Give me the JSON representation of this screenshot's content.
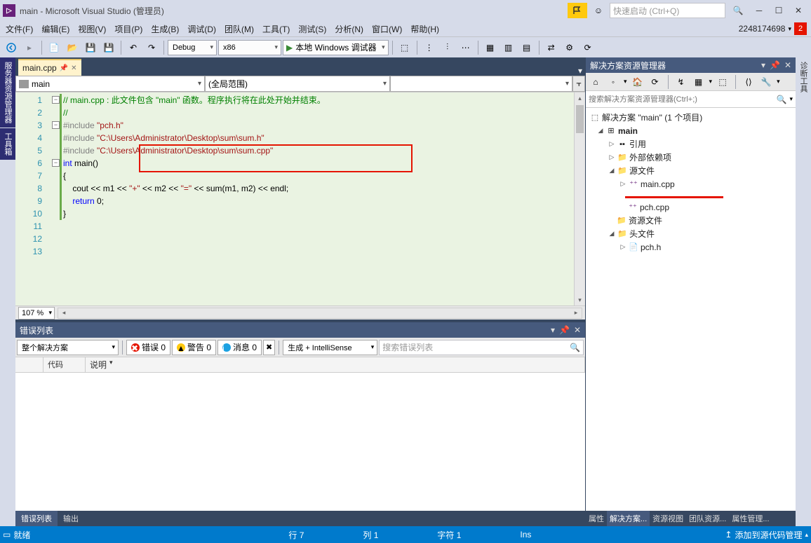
{
  "titlebar": {
    "title": "main - Microsoft Visual Studio  (管理员)",
    "quick_launch_placeholder": "快速启动 (Ctrl+Q)"
  },
  "menubar": {
    "items": [
      "文件(F)",
      "编辑(E)",
      "视图(V)",
      "项目(P)",
      "生成(B)",
      "调试(D)",
      "团队(M)",
      "工具(T)",
      "测试(S)",
      "分析(N)",
      "窗口(W)",
      "帮助(H)"
    ],
    "account_id": "2248174698",
    "notification_count": "2"
  },
  "toolbar": {
    "config": "Debug",
    "platform": "x86",
    "debug_button": "本地 Windows 调试器"
  },
  "doc_tab": {
    "name": "main.cpp"
  },
  "nav": {
    "scope": "main",
    "member": "(全局范围)"
  },
  "editor": {
    "lines": [
      {
        "n": 1,
        "fold": true,
        "cls": "c-comment",
        "text": "// main.cpp : 此文件包含 \"main\" 函数。程序执行将在此处开始并结束。"
      },
      {
        "n": 2,
        "cls": "c-comment",
        "text": "//"
      },
      {
        "n": 3,
        "text": ""
      },
      {
        "n": 4,
        "fold": true,
        "html": "<span class='c-preproc'>#include</span> <span class='c-string'>\"pch.h\"</span>"
      },
      {
        "n": 5,
        "html": "<span class='c-preproc'>#include</span> <span class='c-string'>\"C:\\Users\\Administrator\\Desktop\\sum\\sum.h\"</span>"
      },
      {
        "n": 6,
        "html": "<span class='c-preproc'>#include</span> <span class='c-string'>\"C:\\Users\\Administrator\\Desktop\\sum\\sum.cpp\"</span>"
      },
      {
        "n": 7,
        "text": ""
      },
      {
        "n": 8,
        "fold": true,
        "html": "<span class='c-keyword'>int</span> main()"
      },
      {
        "n": 9,
        "text": "{"
      },
      {
        "n": 10,
        "html": "    cout &lt;&lt; m1 &lt;&lt; <span class='c-string'>\"+\"</span> &lt;&lt; m2 &lt;&lt; <span class='c-string'>\"=\"</span> &lt;&lt; sum(m1, m2) &lt;&lt; endl;"
      },
      {
        "n": 11,
        "html": "    <span class='c-keyword'>return</span> 0;"
      },
      {
        "n": 12,
        "text": "}"
      },
      {
        "n": 13,
        "text": ""
      }
    ],
    "zoom": "107 %"
  },
  "error_panel": {
    "title": "错误列表",
    "scope": "整个解决方案",
    "errors": "错误 0",
    "warnings": "警告 0",
    "messages": "消息 0",
    "build_filter": "生成 + IntelliSense",
    "search_placeholder": "搜索错误列表",
    "columns": [
      "",
      "代码",
      "说明"
    ]
  },
  "bottom_tabs": {
    "items": [
      "错误列表",
      "输出"
    ],
    "active": 0
  },
  "solution_explorer": {
    "title": "解决方案资源管理器",
    "search_placeholder": "搜索解决方案资源管理器(Ctrl+;)",
    "root": "解决方案 \"main\" (1 个项目)",
    "project": "main",
    "nodes": {
      "references": "引用",
      "external": "外部依赖项",
      "source": "源文件",
      "main_cpp": "main.cpp",
      "pch_cpp": "pch.cpp",
      "resources": "资源文件",
      "headers": "头文件",
      "pch_h": "pch.h"
    },
    "tabs": [
      "属性",
      "解决方案...",
      "资源视图",
      "团队资源...",
      "属性管理..."
    ]
  },
  "statusbar": {
    "ready": "就绪",
    "line": "行 7",
    "col": "列 1",
    "char": "字符 1",
    "ins": "Ins",
    "source_control": "添加到源代码管理"
  },
  "left_tabs": [
    "服务器资源管理器",
    "工具箱"
  ],
  "right_tabs": [
    "诊断工具"
  ]
}
